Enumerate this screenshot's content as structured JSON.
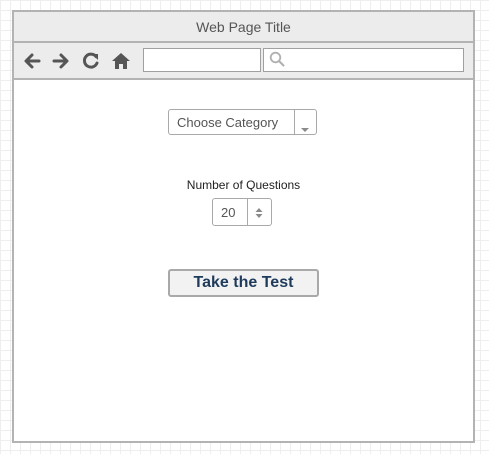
{
  "window": {
    "title": "Web Page Title"
  },
  "toolbar": {
    "icons": [
      "back-arrow-icon",
      "forward-arrow-icon",
      "reload-icon",
      "home-icon"
    ],
    "url": {
      "value": "",
      "placeholder": ""
    },
    "search": {
      "value": "",
      "placeholder": "",
      "icon": "search-icon"
    }
  },
  "form": {
    "category": {
      "selected": "Choose Category",
      "icon": "chevron-down-icon"
    },
    "questions": {
      "label": "Number of Questions",
      "value": "20",
      "icon": "stepper-arrows-icon"
    },
    "submit_label": "Take the Test"
  },
  "colors": {
    "chrome_bg": "#ececec",
    "border": "#b3b3b3",
    "button_text": "#1f3b5c"
  }
}
